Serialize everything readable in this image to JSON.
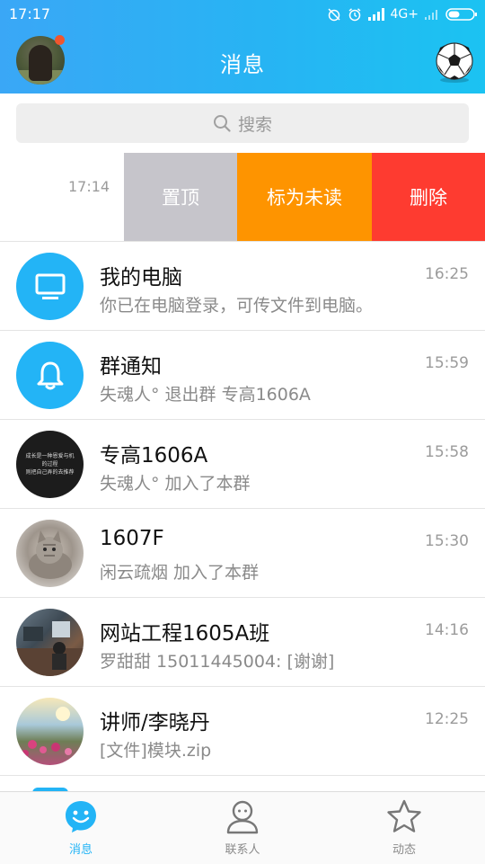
{
  "status_bar": {
    "time": "17:17",
    "network": "4G+"
  },
  "header": {
    "title": "消息"
  },
  "search": {
    "placeholder": "搜索"
  },
  "swiped_row": {
    "time": "17:14",
    "actions": {
      "pin": "置顶",
      "mark_unread": "标为未读",
      "delete": "删除"
    }
  },
  "conversations": [
    {
      "name": "我的电脑",
      "message": "你已在电脑登录，可传文件到电脑。",
      "time": "16:25",
      "avatar": "monitor-icon"
    },
    {
      "name": "群通知",
      "message": "失魂人° 退出群 专高1606A",
      "time": "15:59",
      "avatar": "bell-icon"
    },
    {
      "name": "专高1606A",
      "message": "失魂人° 加入了本群",
      "time": "15:58",
      "avatar": "text-avatar",
      "avatar_text": [
        "成长是一种恩爱与机",
        "的过程",
        "则把自己弄的去推荐"
      ]
    },
    {
      "name": "1607F",
      "message": "闲云疏烟 加入了本群",
      "time": "15:30",
      "avatar": "cat-photo"
    },
    {
      "name": "网站工程1605A班",
      "message": "罗甜甜 15011445004: [谢谢]",
      "time": "14:16",
      "avatar": "office-photo"
    },
    {
      "name": "讲师/李晓丹",
      "message": "[文件]模块.zip",
      "time": "12:25",
      "avatar": "flower-photo"
    }
  ],
  "tab_bar": {
    "tabs": [
      {
        "label": "消息",
        "icon": "chat-face-icon",
        "active": true
      },
      {
        "label": "联系人",
        "icon": "person-icon",
        "active": false
      },
      {
        "label": "动态",
        "icon": "star-icon",
        "active": false
      }
    ]
  },
  "colors": {
    "accent": "#23b4f6",
    "pin": "#c6c5cb",
    "mark_unread": "#fe9400",
    "delete": "#fe3b30"
  }
}
